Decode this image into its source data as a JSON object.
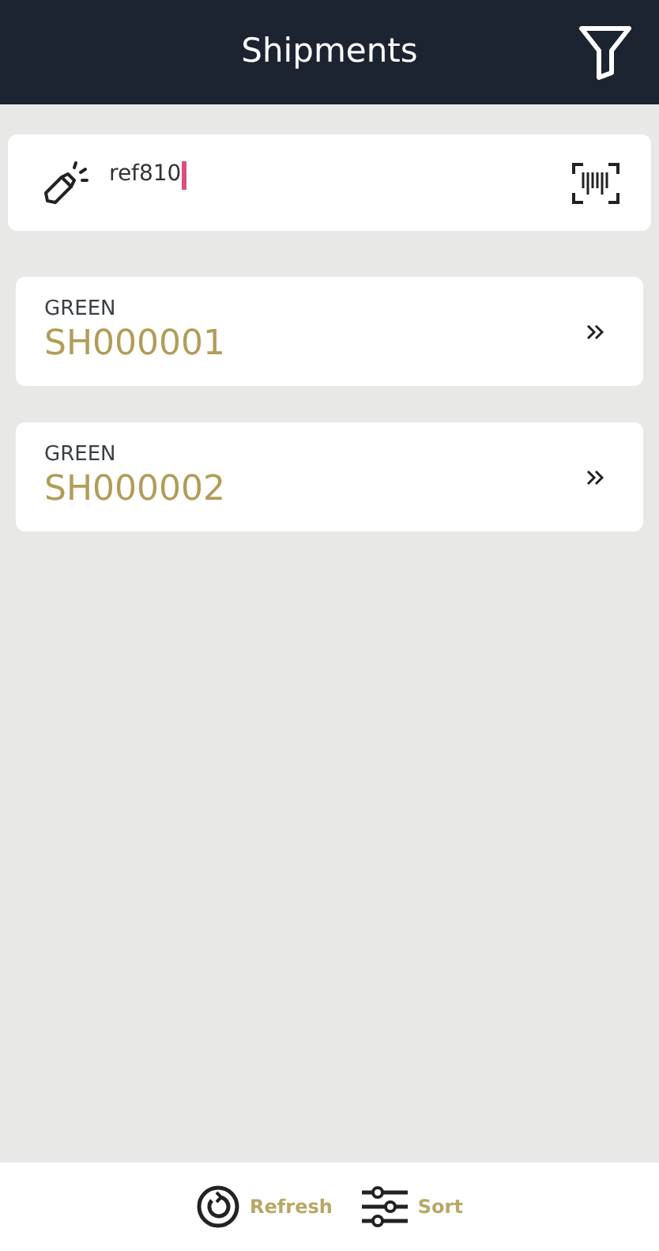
{
  "header": {
    "title": "Shipments"
  },
  "search": {
    "value": "ref810",
    "focused": true
  },
  "shipments": [
    {
      "status": "GREEN",
      "number": "SH000001"
    },
    {
      "status": "GREEN",
      "number": "SH000002"
    }
  ],
  "footer": {
    "buttons": [
      {
        "kind": "refresh",
        "label": "Refresh"
      },
      {
        "kind": "sort",
        "label": "Sort"
      }
    ]
  }
}
